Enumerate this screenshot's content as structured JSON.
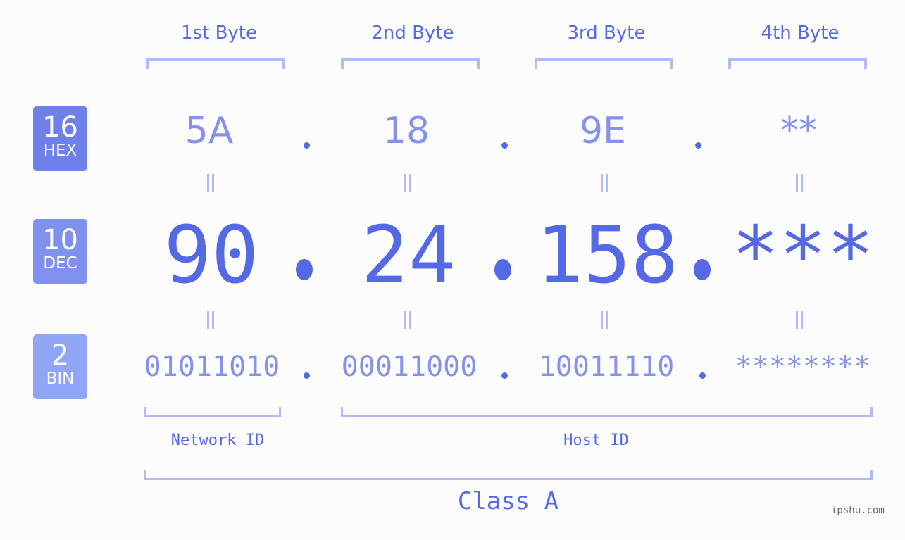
{
  "byte_headers": [
    "1st Byte",
    "2nd Byte",
    "3rd Byte",
    "4th Byte"
  ],
  "badges": [
    {
      "base": "16",
      "label": "HEX",
      "color": "#7080ea"
    },
    {
      "base": "10",
      "label": "DEC",
      "color": "#8090ef"
    },
    {
      "base": "2",
      "label": "BIN",
      "color": "#8fa6f7"
    }
  ],
  "hex_values": [
    "5A",
    "18",
    "9E",
    "**"
  ],
  "dec_values": [
    "90",
    "24",
    "158",
    "***"
  ],
  "bin_values": [
    "01011010",
    "00011000",
    "10011110",
    "********"
  ],
  "network_id_label": "Network ID",
  "host_id_label": "Host ID",
  "class_label": "Class A",
  "watermark": "ipshu.com",
  "colors": {
    "primary": "#5569e6",
    "light": "#8592ed",
    "bracket": "#b0bbf7",
    "background": "#fbfcfb"
  }
}
